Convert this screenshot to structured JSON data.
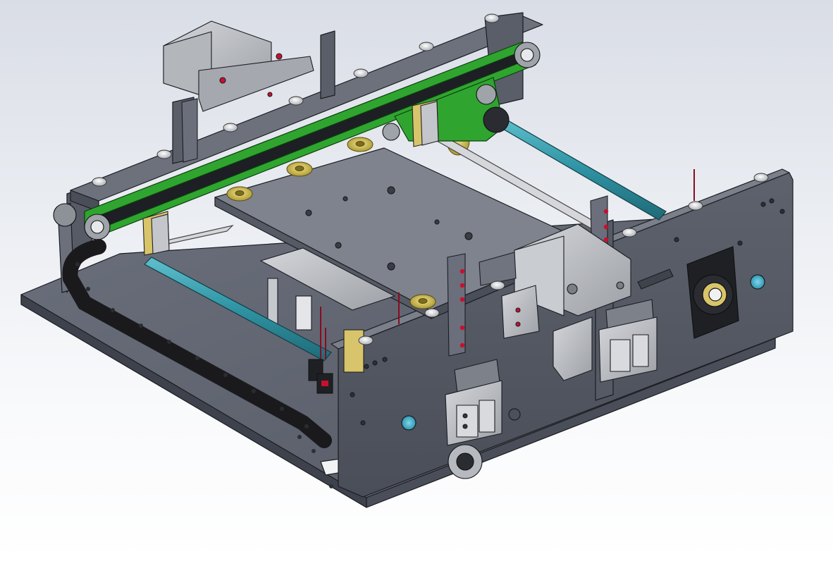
{
  "app": {
    "view_type": "3D CAD model viewport (shaded with edges)",
    "background": "light gradient"
  },
  "colors": {
    "sheet_metal": "#5f6470",
    "sheet_metal_light": "#777c88",
    "sheet_metal_dark": "#3e424c",
    "timing_belt": "#2fa52f",
    "belt_inner": "#1d1f24",
    "linear_shaft": "#2f93a3",
    "brass_washer": "#c9b441",
    "aluminium": "#b9bcc2",
    "drag_chain": "#1a1a1d",
    "red_marker": "#c8102e",
    "cyan_hole": "#2aa5c4"
  },
  "icons": [
    "sheet-metal-frame",
    "timing-belt",
    "linear-shafts",
    "drag-chain",
    "pneumatic-cylinders",
    "bearing-flange",
    "sliding-plate"
  ]
}
